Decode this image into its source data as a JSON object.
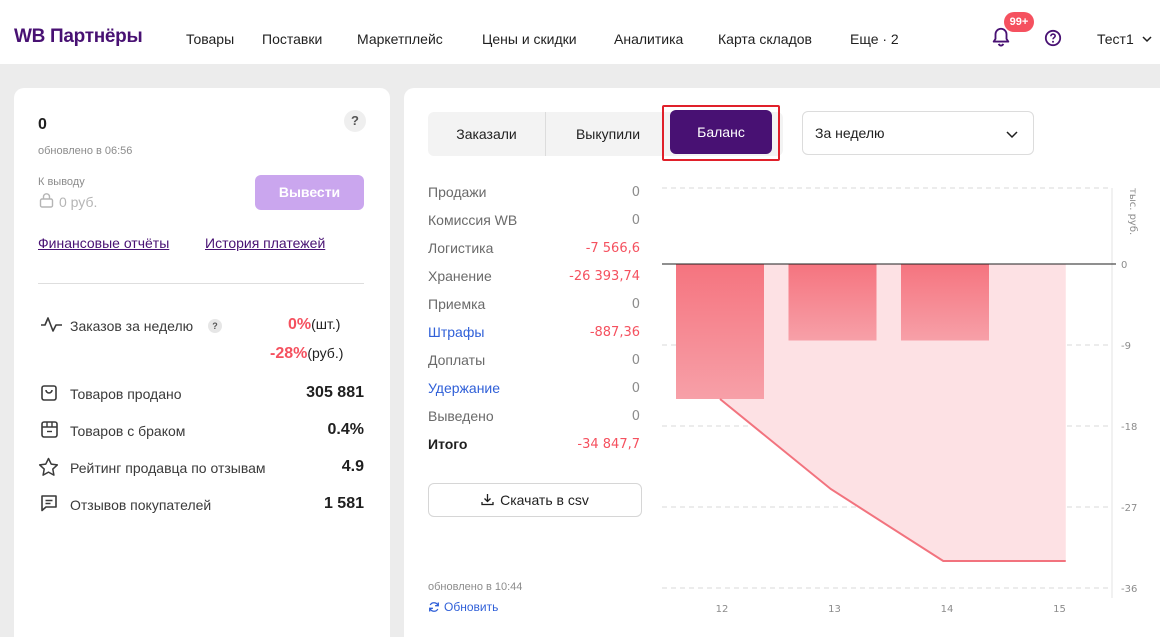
{
  "header": {
    "brand": "WB Партнёры",
    "nav": [
      "Товары",
      "Поставки",
      "Маркетплейс",
      "Цены и скидки",
      "Аналитика",
      "Карта складов",
      "Еще · 2"
    ],
    "notifications_badge": "99+",
    "user": "Тест1"
  },
  "balance_card": {
    "amount": "0",
    "updated": "обновлено в 06:56",
    "help": "?",
    "withdraw_label": "К выводу",
    "withdraw_amount": "0 руб.",
    "withdraw_button": "Вывести",
    "links": [
      "Финансовые отчёты",
      "История платежей"
    ],
    "stats": [
      {
        "label": "Заказов за неделю",
        "icon": "pulse-icon",
        "help": "?",
        "value_pcs": "0%",
        "unit_pcs": "(шт.)",
        "value_rub": "-28%",
        "unit_rub": "(руб.)"
      },
      {
        "label": "Товаров продано",
        "icon": "bag-icon",
        "value": "305 881"
      },
      {
        "label": "Товаров с браком",
        "icon": "box-defect-icon",
        "value": "0.4%"
      },
      {
        "label": "Рейтинг продавца по отзывам",
        "icon": "star-icon",
        "value": "4.9"
      },
      {
        "label": "Отзывов покупателей",
        "icon": "comment-icon",
        "value": "1 581"
      }
    ]
  },
  "finance": {
    "tabs": [
      "Заказали",
      "Выкупили",
      "Баланс"
    ],
    "active_tab": "Баланс",
    "period": "За неделю",
    "rows": [
      {
        "label": "Продажи",
        "value": "0"
      },
      {
        "label": "Комиссия WB",
        "value": "0"
      },
      {
        "label": "Логистика",
        "value": "-7 566,6"
      },
      {
        "label": "Хранение",
        "value": "-26 393,74"
      },
      {
        "label": "Приемка",
        "value": "0"
      },
      {
        "label": "Штрафы",
        "value": "-887,36"
      },
      {
        "label": "Доплаты",
        "value": "0"
      },
      {
        "label": "Удержание",
        "value": "0"
      },
      {
        "label": "Выведено",
        "value": "0"
      },
      {
        "label": "Итого",
        "value": "-34 847,7"
      }
    ],
    "csv_button": "Скачать в csv",
    "updated": "обновлено в 10:44",
    "refresh": "Обновить"
  },
  "chart_data": {
    "type": "bar",
    "ylabel": "тыс. руб.",
    "categories": [
      "12",
      "13",
      "14",
      "15"
    ],
    "series": [
      {
        "values": [
          -15,
          -8.5,
          -8.5,
          0
        ]
      }
    ],
    "cumulative": [
      {
        "x": 12,
        "y": -15
      },
      {
        "x": 13,
        "y": -25
      },
      {
        "x": 14,
        "y": -33
      },
      {
        "x": 15,
        "y": -33
      }
    ],
    "yticks": [
      "0",
      "-9",
      "-18",
      "-27",
      "-36"
    ],
    "ylim": [
      -36,
      0
    ],
    "colors": {
      "bar": "#f48b95",
      "area": "#fde1e4",
      "line": "#f2737e"
    }
  }
}
